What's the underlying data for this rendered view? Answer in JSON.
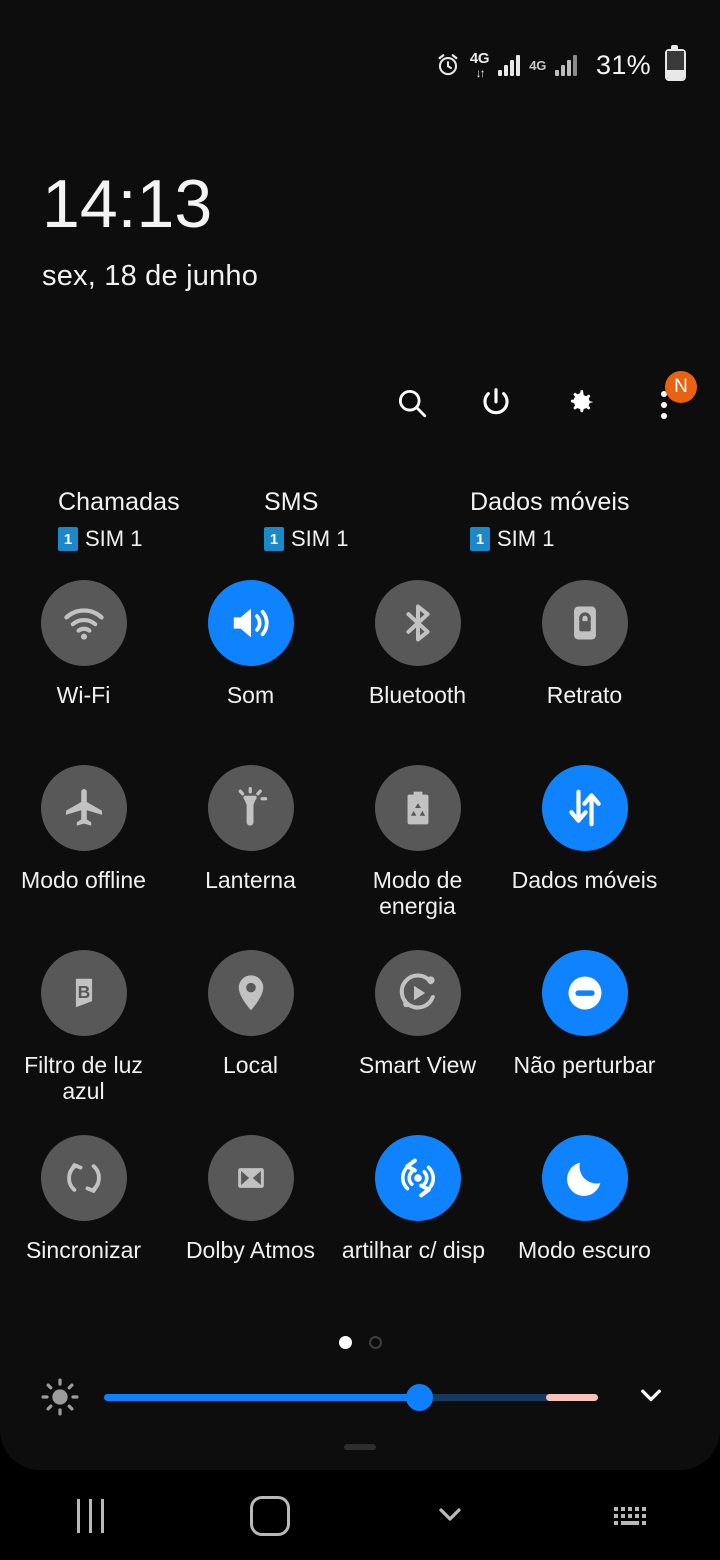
{
  "status_bar": {
    "alarm_icon": "alarm-clock-icon",
    "network_1": {
      "label": "4G",
      "arrows": "↓↑",
      "signal_icon": "signal-bars-icon"
    },
    "network_2": {
      "label": "4G",
      "signal_icon": "signal-bars-icon"
    },
    "battery_percent": "31%",
    "battery_icon": "battery-icon",
    "battery_level": 31
  },
  "clock": {
    "time": "14:13",
    "date": "sex, 18 de junho"
  },
  "toolbar": {
    "search_icon": "search-icon",
    "power_icon": "power-icon",
    "settings_icon": "gear-icon",
    "menu_icon": "kebab-menu-icon",
    "menu_badge": "N",
    "badge_color": "#e8620f"
  },
  "sim_row": [
    {
      "title": "Chamadas",
      "badge": "1",
      "sim": "SIM 1"
    },
    {
      "title": "SMS",
      "badge": "1",
      "sim": "SIM 1"
    },
    {
      "title": "Dados móveis",
      "badge": "1",
      "sim": "SIM 1"
    }
  ],
  "tiles": [
    {
      "label": "Wi-Fi",
      "icon": "wifi-icon",
      "on": false
    },
    {
      "label": "Som",
      "icon": "volume-speaker-icon",
      "on": true
    },
    {
      "label": "Bluetooth",
      "icon": "bluetooth-icon",
      "on": false
    },
    {
      "label": "Retrato",
      "icon": "rotation-lock-icon",
      "on": false
    },
    {
      "label": "Modo offline",
      "icon": "airplane-icon",
      "on": false
    },
    {
      "label": "Lanterna",
      "icon": "flashlight-icon",
      "on": false
    },
    {
      "label": "Modo de energia",
      "icon": "power-saving-battery-icon",
      "on": false
    },
    {
      "label": "Dados móveis",
      "icon": "data-arrows-icon",
      "on": true
    },
    {
      "label": "Filtro de luz azul",
      "icon": "blue-light-filter-icon",
      "on": false
    },
    {
      "label": "Local",
      "icon": "location-pin-icon",
      "on": false
    },
    {
      "label": "Smart View",
      "icon": "smart-view-icon",
      "on": false
    },
    {
      "label": "Não perturbar",
      "icon": "do-not-disturb-icon",
      "on": true
    },
    {
      "label": "Sincronizar",
      "icon": "sync-icon",
      "on": false
    },
    {
      "label": "Dolby Atmos",
      "icon": "dolby-atmos-icon",
      "on": false
    },
    {
      "label": "artilhar c/ disp",
      "icon": "share-to-device-icon",
      "on": true,
      "truncated": true
    },
    {
      "label": "Modo escuro",
      "icon": "moon-icon",
      "on": true
    }
  ],
  "pagination": {
    "pages": 2,
    "current": 1
  },
  "brightness": {
    "icon": "brightness-sun-icon",
    "value_percent": 64,
    "warm_segment": true,
    "expand_icon": "chevron-down-icon",
    "track_color": "#0f7ffd",
    "warm_color": "#f6c2bc"
  },
  "nav_bar": {
    "recents": "recents-icon",
    "home": "home-icon",
    "back": "back-chevron-icon",
    "keyboard": "keyboard-icon"
  },
  "theme": {
    "accent_on": "#0f82fe",
    "tile_off": "#585858",
    "panel_bg": "#0d0d0d",
    "screen_bg": "#000000"
  }
}
